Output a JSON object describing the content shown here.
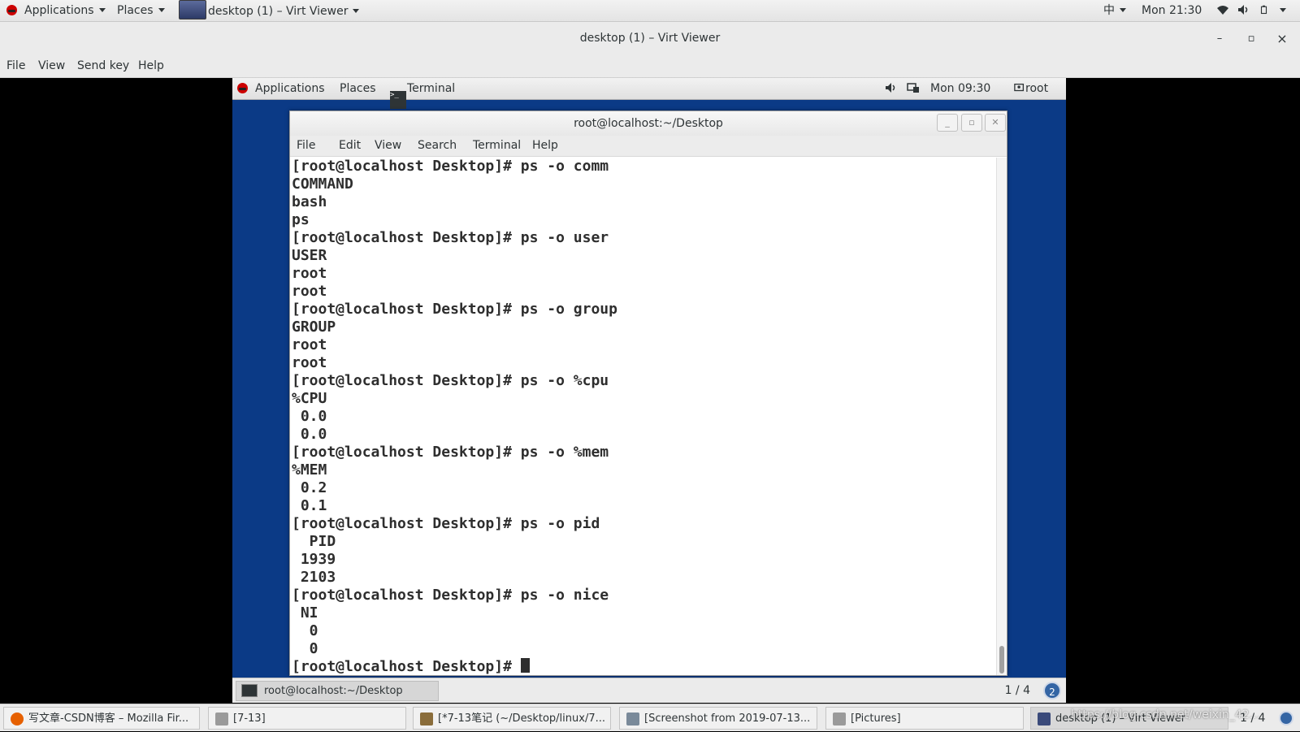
{
  "host_top": {
    "applications": "Applications",
    "places": "Places",
    "window_label": "desktop (1) – Virt Viewer",
    "input_method": "中",
    "clock": "Mon 21:30"
  },
  "window": {
    "title": "desktop (1) – Virt Viewer",
    "minimize": "–",
    "maximize": "▫",
    "close": "×"
  },
  "menubar": [
    "File",
    "View",
    "Send key",
    "Help"
  ],
  "guest": {
    "top": {
      "applications": "Applications",
      "places": "Places",
      "terminal": "Terminal",
      "clock": "Mon 09:30",
      "user": "root"
    },
    "terminal": {
      "title": "root@localhost:~/Desktop",
      "menu": [
        "File",
        "Edit",
        "View",
        "Search",
        "Terminal",
        "Help"
      ],
      "lines": [
        "[root@localhost Desktop]# ps -o comm",
        "COMMAND",
        "bash",
        "ps",
        "[root@localhost Desktop]# ps -o user",
        "USER",
        "root",
        "root",
        "[root@localhost Desktop]# ps -o group",
        "GROUP",
        "root",
        "root",
        "[root@localhost Desktop]# ps -o %cpu",
        "%CPU",
        " 0.0",
        " 0.0",
        "[root@localhost Desktop]# ps -o %mem",
        "%MEM",
        " 0.2",
        " 0.1",
        "[root@localhost Desktop]# ps -o pid",
        "  PID",
        " 1939",
        " 2103",
        "[root@localhost Desktop]# ps -o nice",
        " NI",
        "  0",
        "  0"
      ],
      "prompt": "[root@localhost Desktop]# "
    },
    "bottom": {
      "task": "root@localhost:~/Desktop",
      "pager": "1 / 4",
      "badge": "2"
    }
  },
  "taskbar": {
    "tasks": [
      {
        "label": "写文章-CSDN博客 – Mozilla Fir...",
        "color": "#e66000"
      },
      {
        "label": "[7-13]",
        "color": "#9a9a9a"
      },
      {
        "label": "[*7-13笔记 (~/Desktop/linux/7...",
        "color": "#8a6d3b"
      },
      {
        "label": "[Screenshot from 2019-07-13...",
        "color": "#7a8a9a"
      },
      {
        "label": "[Pictures]",
        "color": "#9a9a9a"
      },
      {
        "label": "desktop (1) – Virt Viewer",
        "color": "#3a4a7a"
      }
    ],
    "pager": "1 / 4"
  },
  "watermark": "https://blog.csdn.net/weixin_42..."
}
